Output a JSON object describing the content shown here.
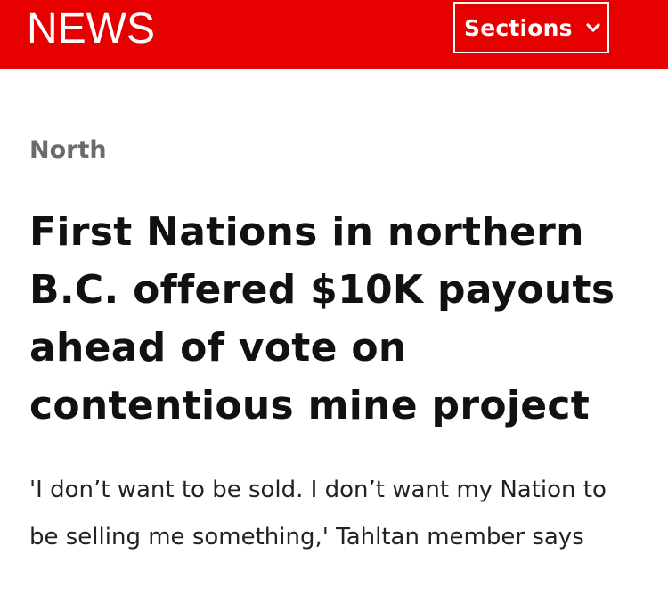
{
  "header": {
    "logo_text": "NEWS",
    "sections_label": "Sections",
    "sections_icon": "chevron-down-icon",
    "brand_color": "#e60000"
  },
  "article": {
    "section": "North",
    "headline": "First Nations in northern B.C. offered $10K payouts ahead of vote on contentious mine project",
    "deck": "'I don’t want to be sold. I don’t want my Nation to be selling me something,' Tahltan member says"
  }
}
